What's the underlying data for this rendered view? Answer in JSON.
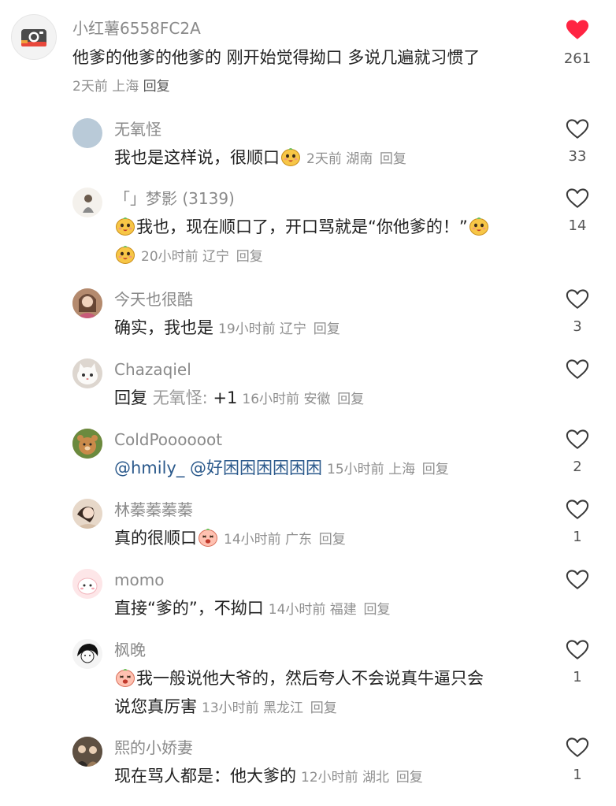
{
  "main_comment": {
    "username": "小红薯6558FC2A",
    "text": "他爹的他爹的他爹的 刚开始觉得拗口 多说几遍就习惯了",
    "meta": "2天前 上海",
    "reply_label": "回复",
    "likes": "261",
    "liked": true
  },
  "replies": [
    {
      "username": "无氧怪",
      "text": "我也是这样说，很顺口",
      "meta": "2天前 湖南",
      "reply_label": "回复",
      "likes": "33"
    },
    {
      "username": "「」梦影 (3139)",
      "text_a": "我也，现在顺口了，开口骂就是“你他爹的！”",
      "meta": "20小时前 辽宁",
      "reply_label": "回复",
      "likes": "14"
    },
    {
      "username": "今天也很酷",
      "text": "确实，我也是",
      "meta": "19小时前 辽宁",
      "reply_label": "回复",
      "likes": "3"
    },
    {
      "username": "Chazaqiel",
      "prefix": "回复",
      "reply_to": "无氧怪:",
      "text": "+1",
      "meta": "16小时前 安徽",
      "reply_label": "回复",
      "likes": ""
    },
    {
      "username": "ColdPoooooot",
      "text": "@hmily_ @好困困困困困困",
      "meta": "15小时前 上海",
      "reply_label": "回复",
      "likes": "2"
    },
    {
      "username": "林蓁蓁蓁蓁",
      "text": "真的很顺口",
      "meta": "14小时前 广东",
      "reply_label": "回复",
      "likes": "1"
    },
    {
      "username": "momo",
      "text": "直接“爹的”，不拗口",
      "meta": "14小时前 福建",
      "reply_label": "回复",
      "likes": ""
    },
    {
      "username": "枫晚",
      "text_a": "我一般说他大爷的，然后夸人不会说真牛逼只会",
      "text_b": "说您真厉害",
      "meta": "13小时前 黑龙江",
      "reply_label": "回复",
      "likes": "1"
    },
    {
      "username": "熙的小娇妻",
      "text": "现在骂人都是：他大爹的",
      "meta": "12小时前 湖北",
      "reply_label": "回复",
      "likes": "1"
    }
  ],
  "colors": {
    "liked": "#ff2442",
    "outline": "#3a3a3a",
    "muted": "#8f8f8f",
    "mention": "#2c5a8c"
  },
  "icons": {
    "like": "heart-icon",
    "emoji": "emoji-icon"
  }
}
